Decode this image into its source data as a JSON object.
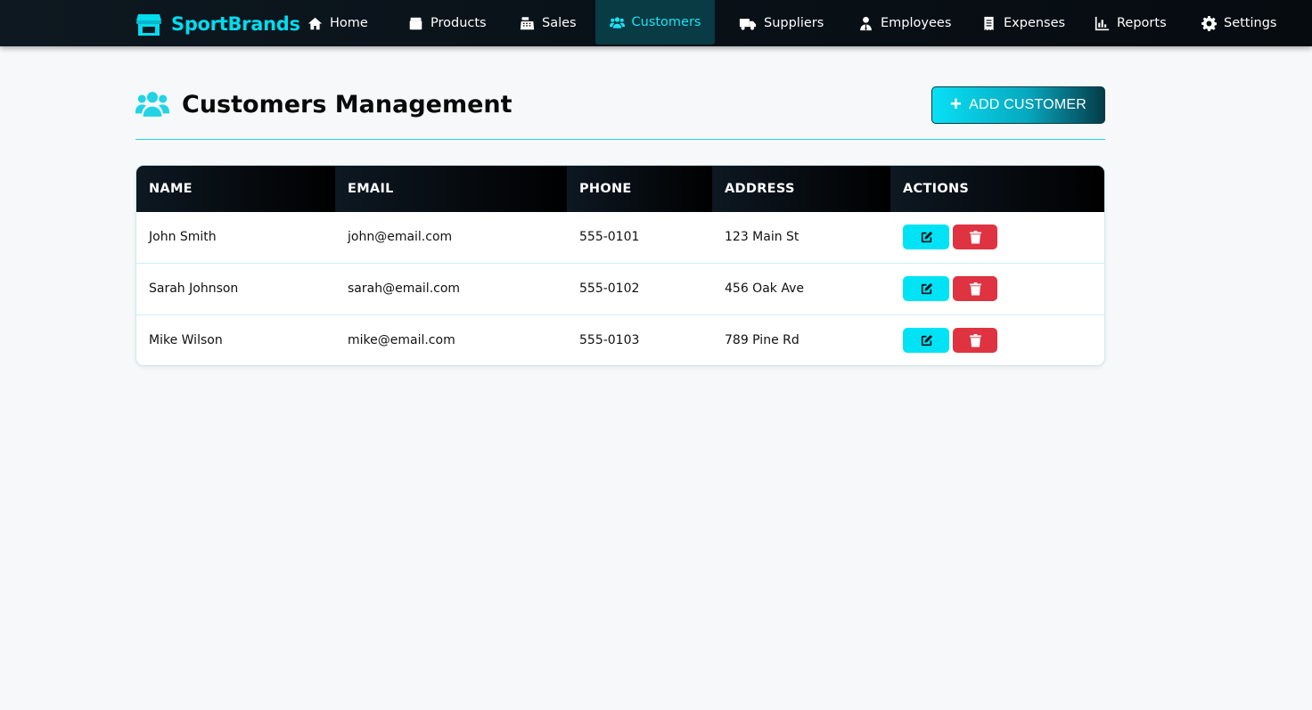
{
  "brand": {
    "name": "SportBrands",
    "icon": "store-icon"
  },
  "nav": [
    {
      "label": "Home",
      "icon": "home-icon"
    },
    {
      "label": "Products",
      "icon": "box-icon"
    },
    {
      "label": "Sales",
      "icon": "cash-register-icon"
    },
    {
      "label": "Customers",
      "icon": "users-icon",
      "active": true
    },
    {
      "label": "Suppliers",
      "icon": "truck-icon"
    },
    {
      "label": "Employees",
      "icon": "user-tie-icon"
    },
    {
      "label": "Expenses",
      "icon": "receipt-icon"
    },
    {
      "label": "Reports",
      "icon": "chart-icon"
    },
    {
      "label": "Settings",
      "icon": "gear-icon"
    }
  ],
  "header": {
    "title": "Customers Management",
    "icon": "users-icon",
    "add_button_label": "ADD CUSTOMER"
  },
  "table": {
    "columns": [
      "NAME",
      "EMAIL",
      "PHONE",
      "ADDRESS",
      "ACTIONS"
    ],
    "rows": [
      {
        "name": "John Smith",
        "email": "john@email.com",
        "phone": "555-0101",
        "address": "123 Main St"
      },
      {
        "name": "Sarah Johnson",
        "email": "sarah@email.com",
        "phone": "555-0102",
        "address": "456 Oak Ave"
      },
      {
        "name": "Mike Wilson",
        "email": "mike@email.com",
        "phone": "555-0103",
        "address": "789 Pine Rd"
      }
    ]
  },
  "colors": {
    "accent": "#00dcf0",
    "nav_bg": "#0d1820",
    "active_tab_bg": "#083b44",
    "edit_button": "#00e3f5",
    "delete_button": "#df3341",
    "page_bg": "#f6f8fa"
  }
}
